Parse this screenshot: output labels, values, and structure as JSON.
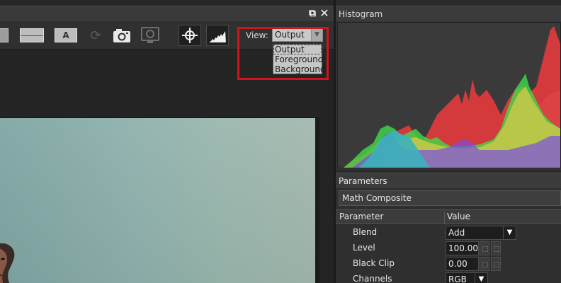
{
  "viewer": {
    "toolbar": {
      "view_label": "View:",
      "view_value": "Output",
      "label_tool_letter": "A",
      "refresh_glyph": "⟳",
      "icons": [
        "frame-icon",
        "split-view-icon",
        "text-label-icon",
        "refresh-icon",
        "snapshot-camera-icon",
        "compare-snapshot-icon",
        "crosshair-target-icon",
        "histogram-icon"
      ]
    },
    "view_dropdown": {
      "options": [
        "Output",
        "Foreground",
        "Background"
      ],
      "selected": "Output"
    },
    "window_controls": {
      "restore_glyph": "⧉",
      "close_glyph": "✕"
    }
  },
  "histogram": {
    "title": "Histogram",
    "channel_colors": {
      "red": "#e0393c",
      "green": "#38e048",
      "blue": "#7850f0",
      "yellow": "#c8c83a",
      "cyan": "#3cb4be",
      "luma": "#a0a0a0"
    }
  },
  "parameters": {
    "title": "Parameters",
    "effect_name": "Math Composite",
    "columns": [
      "Parameter",
      "Value"
    ],
    "rows": [
      {
        "label": "Blend",
        "value": "Add",
        "type": "combo"
      },
      {
        "label": "Level",
        "value": "100.00",
        "type": "spin"
      },
      {
        "label": "Black Clip",
        "value": "0.00",
        "type": "spin"
      },
      {
        "label": "Channels",
        "value": "RGB",
        "type": "combo"
      }
    ]
  },
  "colors": {
    "highlight": "#d0141c",
    "panel": "#2f2f2f",
    "titlebar": "#3b3b3b"
  }
}
